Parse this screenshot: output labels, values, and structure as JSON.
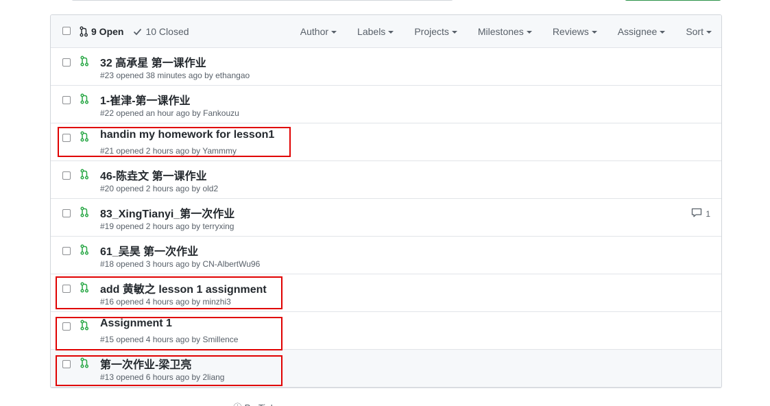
{
  "header": {
    "open_label": "9 Open",
    "closed_label": "10 Closed",
    "filters": [
      "Author",
      "Labels",
      "Projects",
      "Milestones",
      "Reviews",
      "Assignee",
      "Sort"
    ]
  },
  "pulls": [
    {
      "title": "32 高承星 第一课作业",
      "meta": "#23 opened 38 minutes ago by ethangao"
    },
    {
      "title": "1-崔津-第一课作业",
      "meta": "#22 opened an hour ago by Fankouzu"
    },
    {
      "title": "handin my homework for lesson1",
      "meta": "#21 opened 2 hours ago by Yammmy"
    },
    {
      "title": "46-陈垚文 第一课作业",
      "meta": "#20 opened 2 hours ago by old2"
    },
    {
      "title": "83_XingTianyi_第一次作业",
      "meta": "#19 opened 2 hours ago by terryxing",
      "comments": "1"
    },
    {
      "title": "61_吴昊 第一次作业",
      "meta": "#18 opened 3 hours ago by CN-AlbertWu96"
    },
    {
      "title": "add 黄敏之 lesson 1 assignment",
      "meta": "#16 opened 4 hours ago by minzhi3"
    },
    {
      "title": "Assignment 1",
      "meta": "#15 opened 4 hours ago by Smillence"
    },
    {
      "title": "第一次作业-梁卫亮",
      "meta": "#13 opened 6 hours ago by 2liang"
    }
  ],
  "footer_hint": "ⓘ ProTip! ...",
  "colors": {
    "open_green": "#28a745",
    "highlight_red": "#e00000",
    "link_dark": "#24292e",
    "muted": "#586069"
  }
}
